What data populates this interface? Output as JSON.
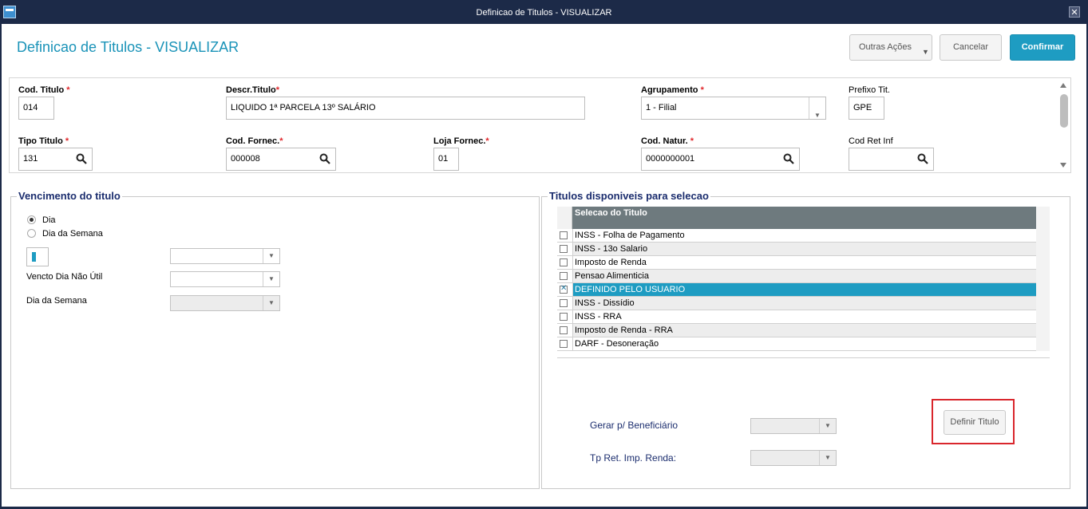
{
  "window": {
    "title": "Definicao de Titulos - VISUALIZAR",
    "close_glyph": "✕"
  },
  "header": {
    "title": "Definicao de Titulos - VISUALIZAR"
  },
  "toolbar": {
    "other_actions": "Outras Ações",
    "cancel": "Cancelar",
    "confirm": "Confirmar"
  },
  "fields": {
    "cod_titulo": {
      "label": "Cod. Titulo",
      "required": "*",
      "value": "014"
    },
    "descr_titulo": {
      "label": "Descr.Titulo",
      "required": "*",
      "value": "LIQUIDO 1ª PARCELA 13º SALÁRIO"
    },
    "agrupamento": {
      "label": "Agrupamento",
      "required": "*",
      "value": "1 - Filial"
    },
    "prefixo": {
      "label": "Prefixo Tit.",
      "value": "GPE"
    },
    "tipo_titulo": {
      "label": "Tipo Titulo",
      "required": "*",
      "value": "131"
    },
    "cod_fornec": {
      "label": "Cod. Fornec.",
      "required": "*",
      "value": "000008"
    },
    "loja_fornec": {
      "label": "Loja Fornec.",
      "required": "*",
      "value": "01"
    },
    "cod_natur": {
      "label": "Cod. Natur.",
      "required": "*",
      "value": "0000000001"
    },
    "cod_ret_inf": {
      "label": "Cod Ret Inf",
      "value": ""
    }
  },
  "vencimento": {
    "title": "Vencimento do titulo",
    "radio_dia": "Dia",
    "radio_dia_semana": "Dia da Semana",
    "selected": "Dia",
    "vencto_nao_util_label": "Vencto Dia Não Útil",
    "dia_semana_label": "Dia da Semana"
  },
  "titulos": {
    "title": "Titulos disponiveis para selecao",
    "column_header": "Selecao do Titulo",
    "rows": [
      {
        "label": "INSS - Folha de Pagamento",
        "checked": false
      },
      {
        "label": "INSS - 13o Salario",
        "checked": false
      },
      {
        "label": "Imposto de Renda",
        "checked": false
      },
      {
        "label": "Pensao Alimenticia",
        "checked": false
      },
      {
        "label": "DEFINIDO PELO USUARIO",
        "checked": true
      },
      {
        "label": "INSS - Dissídio",
        "checked": false
      },
      {
        "label": "INSS - RRA",
        "checked": false
      },
      {
        "label": "Imposto de Renda - RRA",
        "checked": false
      },
      {
        "label": "DARF - Desoneração",
        "checked": false
      }
    ],
    "gerar_label": "Gerar p/ Beneficiário",
    "tp_ret_label": "Tp Ret. Imp. Renda:",
    "definir_button": "Definir Titulo"
  },
  "colors": {
    "accent": "#1e9cc2",
    "title_bar": "#1c2a48",
    "group_title": "#1b2d6e",
    "highlight": "#d9262c"
  }
}
